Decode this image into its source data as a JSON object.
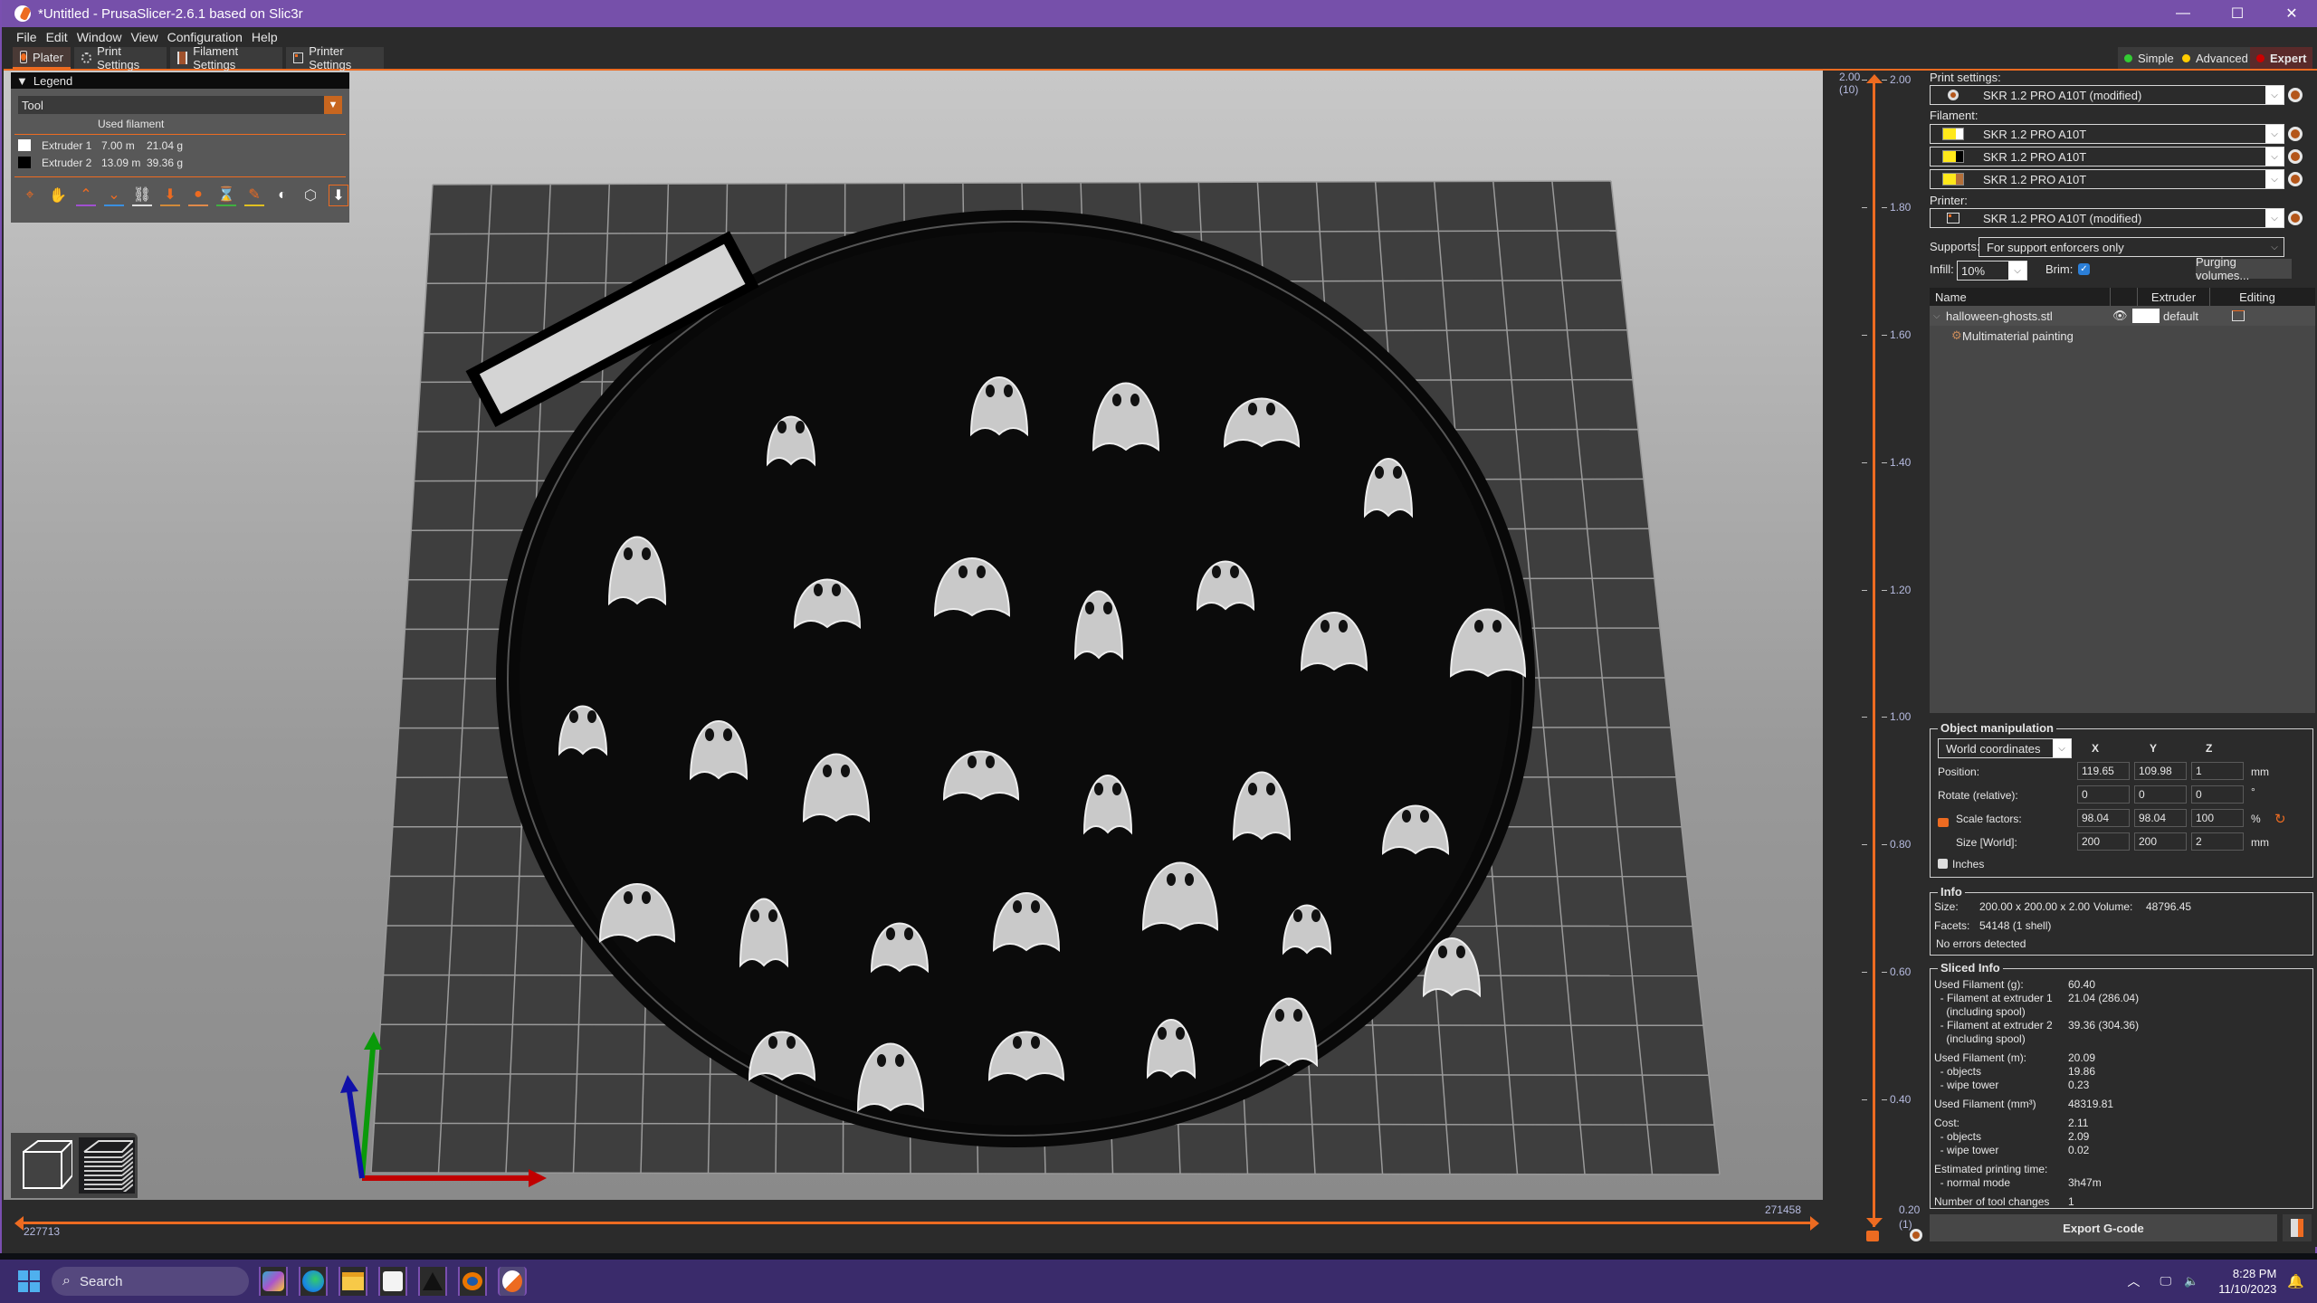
{
  "window": {
    "title": "*Untitled - PrusaSlicer-2.6.1 based on Slic3r",
    "minimize": "—",
    "maximize": "☐",
    "close": "✕"
  },
  "menu": [
    "File",
    "Edit",
    "Window",
    "View",
    "Configuration",
    "Help"
  ],
  "tabs": [
    {
      "label": "Plater",
      "icon": "plater-icon",
      "active": true
    },
    {
      "label": "Print Settings",
      "icon": "cog-icon",
      "active": false
    },
    {
      "label": "Filament Settings",
      "icon": "spool-icon",
      "active": false
    },
    {
      "label": "Printer Settings",
      "icon": "printer-icon",
      "active": false
    }
  ],
  "modes": [
    {
      "label": "Simple",
      "color": "#33cc33"
    },
    {
      "label": "Advanced",
      "color": "#ffcc00"
    },
    {
      "label": "Expert",
      "color": "#cc0000",
      "active": true
    }
  ],
  "legend": {
    "title": "Legend",
    "view_type": "Tool",
    "column_header": "Used filament",
    "rows": [
      {
        "name": "Extruder 1",
        "length": "7.00 m",
        "weight": "21.04 g",
        "color": "#ffffff"
      },
      {
        "name": "Extruder 2",
        "length": "13.09 m",
        "weight": "39.36 g",
        "color": "#000000"
      }
    ],
    "toolbar_icons": [
      "travel-icon",
      "wipe-icon",
      "retractions-icon",
      "deretractions-icon",
      "seams-icon",
      "tool-changes-icon",
      "color-changes-icon",
      "pause-prints-icon",
      "custom-gcode-icon",
      "center-of-gravity-icon",
      "shells-icon",
      "tool-marker-icon"
    ]
  },
  "vertical_slider": {
    "top_label": "2.00",
    "top_layer": "(10)",
    "bottom_label": "0.20",
    "bottom_layer": "(1)",
    "ticks": [
      "2.00",
      "1.80",
      "1.60",
      "1.40",
      "1.20",
      "1.00",
      "0.80",
      "0.60",
      "0.40"
    ]
  },
  "horizontal_slider": {
    "left_value": "227713",
    "right_value": "271458"
  },
  "sidebar": {
    "print_settings_label": "Print settings:",
    "print_settings_value": "SKR 1.2 PRO A10T (modified)",
    "filament_label": "Filament:",
    "filaments": [
      {
        "value": "SKR 1.2 PRO A10T",
        "color_a": "#ffe81a",
        "color_b": "#ffffff"
      },
      {
        "value": "SKR 1.2 PRO A10T",
        "color_a": "#ffe81a",
        "color_b": "#000000"
      },
      {
        "value": "SKR 1.2 PRO A10T",
        "color_a": "#ffe81a",
        "color_b": "#b5703a"
      }
    ],
    "printer_label": "Printer:",
    "printer_value": "SKR 1.2 PRO A10T (modified)",
    "supports_label": "Supports:",
    "supports_value": "For support enforcers only",
    "infill_label": "Infill:",
    "infill_value": "10%",
    "brim_label": "Brim:",
    "brim_checked": true,
    "purging_button": "Purging volumes...",
    "object_list": {
      "headers": [
        "Name",
        "",
        "Extruder",
        "Editing"
      ],
      "object_name": "halloween-ghosts.stl",
      "extruder": "default",
      "sub_item": "Multimaterial painting"
    },
    "manipulation": {
      "title": "Object manipulation",
      "coords": "World coordinates",
      "axes": [
        "X",
        "Y",
        "Z"
      ],
      "position_label": "Position:",
      "position": [
        "119.65",
        "109.98",
        "1"
      ],
      "position_unit": "mm",
      "rotate_label": "Rotate (relative):",
      "rotate": [
        "0",
        "0",
        "0"
      ],
      "rotate_unit": "°",
      "scale_label": "Scale factors:",
      "scale": [
        "98.04",
        "98.04",
        "100"
      ],
      "scale_unit": "%",
      "size_label": "Size [World]:",
      "size": [
        "200",
        "200",
        "2"
      ],
      "size_unit": "mm",
      "inches_label": "Inches"
    },
    "info": {
      "title": "Info",
      "size_label": "Size:",
      "size_value": "200.00 x 200.00 x 2.00",
      "volume_label": "Volume:",
      "volume_value": "48796.45",
      "facets_label": "Facets:",
      "facets_value": "54148 (1 shell)",
      "errors": "No errors detected"
    },
    "sliced_info": {
      "title": "Sliced Info",
      "rows": [
        {
          "label": "Used Filament (g):",
          "value": "60.40"
        },
        {
          "label": "  - Filament at extruder 1",
          "value": "21.04 (286.04)"
        },
        {
          "label": "    (including spool)",
          "value": ""
        },
        {
          "label": "  - Filament at extruder 2",
          "value": "39.36 (304.36)"
        },
        {
          "label": "    (including spool)",
          "value": ""
        },
        {
          "label": "Used Filament (m):",
          "value": "20.09"
        },
        {
          "label": "  - objects",
          "value": "19.86"
        },
        {
          "label": "  - wipe tower",
          "value": "0.23"
        },
        {
          "label": "Used Filament (mm³)",
          "value": "48319.81"
        },
        {
          "label": "Cost:",
          "value": "2.11"
        },
        {
          "label": "  - objects",
          "value": "2.09"
        },
        {
          "label": "  - wipe tower",
          "value": "0.02"
        },
        {
          "label": "Estimated printing time:",
          "value": ""
        },
        {
          "label": "  - normal mode",
          "value": "3h47m"
        },
        {
          "label": "Number of tool changes",
          "value": "1"
        }
      ]
    },
    "export_button": "Export G-code"
  },
  "taskbar": {
    "search_placeholder": "Search",
    "apps": [
      "copilot-icon",
      "edge-icon",
      "file-explorer-icon",
      "ms-store-icon",
      "inkscape-icon",
      "blender-icon",
      "prusaslicer-icon"
    ],
    "time": "8:28 PM",
    "date": "11/10/2023"
  }
}
